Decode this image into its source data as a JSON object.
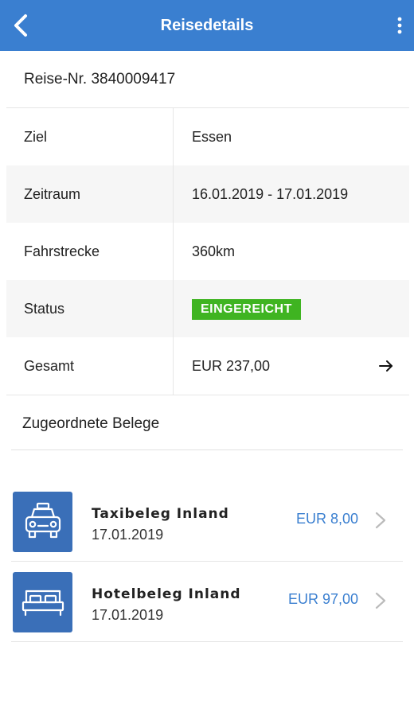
{
  "appbar": {
    "title": "Reisedetails",
    "back_icon": "chevron-left-icon",
    "menu_icon": "more-vertical-icon",
    "color": "#3a7fd0"
  },
  "trip": {
    "number_label": "Reise-Nr. 3840009417"
  },
  "details": {
    "ziel_label": "Ziel",
    "ziel_value": "Essen",
    "zeitraum_label": "Zeitraum",
    "zeitraum_value": "16.01.2019 - 17.01.2019",
    "strecke_label": "Fahrstrecke",
    "strecke_value": "360km",
    "status_label": "Status",
    "status_value": "EINGEREICHT",
    "status_color": "#3fb421",
    "gesamt_label": "Gesamt",
    "gesamt_value": "EUR 237,00",
    "gesamt_icon": "arrow-right-icon"
  },
  "receipts": {
    "section_title": "Zugeordnete Belege",
    "items": [
      {
        "name": "Taxibeleg Inland",
        "date": "17.01.2019",
        "amount": "EUR 8,00",
        "icon": "taxi-icon"
      },
      {
        "name": "Hotelbeleg Inland",
        "date": "17.01.2019",
        "amount": "EUR 97,00",
        "icon": "bed-icon"
      }
    ],
    "icon_bg": "#3a6fb8",
    "amount_color": "#3a7fd0"
  }
}
